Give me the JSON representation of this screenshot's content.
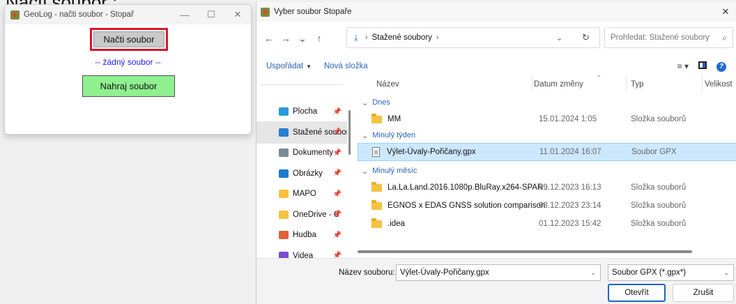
{
  "overlay_caption": "Načti soubor :",
  "app": {
    "title": "GeoLog - načti soubor - Stopař",
    "minimize": "—",
    "maximize": "☐",
    "close": "✕",
    "load_button": "Načti soubor",
    "status": "-- žádný soubor --",
    "upload_button": "Nahraj soubor",
    "colors": {
      "highlight": "#e0142a",
      "status_text": "#1d1ee8",
      "upload_bg": "#8ff08f"
    }
  },
  "dialog": {
    "title": "Vyber soubor Stopaře",
    "close": "✕",
    "nav": {
      "back": "←",
      "forward": "→",
      "history": "⌄",
      "up": "↑"
    },
    "address": {
      "folder": "Stažené soubory",
      "separator": "›"
    },
    "search_placeholder": "Prohledat: Stažené soubory",
    "toolbar": {
      "organize": "Uspořádat",
      "new_folder": "Nová složka"
    },
    "sidebar": [
      {
        "label": "Plocha",
        "icon": "desktop-icon",
        "color": "#2a9ad8"
      },
      {
        "label": "Stažené soubory",
        "icon": "download-icon",
        "color": "#2b7cd3"
      },
      {
        "label": "Dokumenty",
        "icon": "document-icon",
        "color": "#7a8a99"
      },
      {
        "label": "Obrázky",
        "icon": "pictures-icon",
        "color": "#1e7ad0"
      },
      {
        "label": "MAPO",
        "icon": "folder-icon",
        "color": "#f5c242"
      },
      {
        "label": "OneDrive - Č",
        "icon": "folder-icon",
        "color": "#f5c242"
      },
      {
        "label": "Hudba",
        "icon": "music-icon",
        "color": "#e0603a"
      },
      {
        "label": "Videa",
        "icon": "video-icon",
        "color": "#7b4fd0"
      }
    ],
    "columns": {
      "name": "Název",
      "date": "Datum změny",
      "type": "Typ",
      "size": "Velikost"
    },
    "groups": [
      {
        "label": "Dnes",
        "rows": [
          {
            "name": "MM",
            "date": "15.01.2024 1:05",
            "type": "Složka souborů",
            "kind": "folder"
          }
        ]
      },
      {
        "label": "Minulý týden",
        "rows": [
          {
            "name": "Výlet-Úvaly-Pořičany.gpx",
            "date": "11.01.2024 16:07",
            "type": "Soubor GPX",
            "kind": "file",
            "selected": true
          }
        ]
      },
      {
        "label": "Minulý měsíc",
        "rows": [
          {
            "name": "La.La.Land.2016.1080p.BluRay.x264-SPAR...",
            "date": "09.12.2023 16:13",
            "type": "Složka souborů",
            "kind": "folder"
          },
          {
            "name": "EGNOS x EDAS GNSS solution comparison",
            "date": "08.12.2023 23:14",
            "type": "Složka souborů",
            "kind": "folder"
          },
          {
            "name": ".idea",
            "date": "01.12.2023 15:42",
            "type": "Složka souborů",
            "kind": "folder"
          }
        ]
      }
    ],
    "filename_label": "Název souboru:",
    "filename_value": "Výlet-Úvaly-Pořičany.gpx",
    "filter": "Soubor GPX (*.gpx*)",
    "open_button": "Otevřít",
    "cancel_button": "Zrušit"
  }
}
